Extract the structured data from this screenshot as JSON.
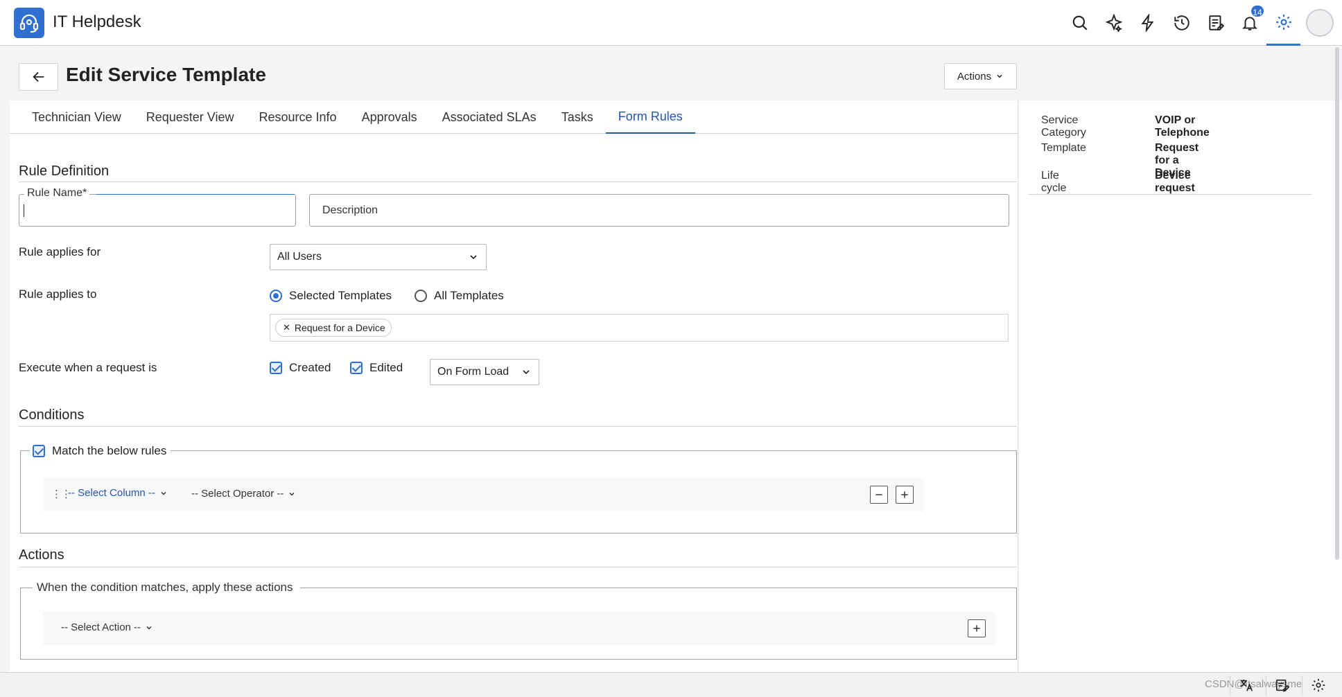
{
  "app": {
    "title": "IT Helpdesk"
  },
  "topbar": {
    "notification_count": "14"
  },
  "page": {
    "title": "Edit Service Template",
    "actions_label": "Actions"
  },
  "tabs": [
    {
      "label": "Technician View"
    },
    {
      "label": "Requester View"
    },
    {
      "label": "Resource Info"
    },
    {
      "label": "Approvals"
    },
    {
      "label": "Associated SLAs"
    },
    {
      "label": "Tasks"
    },
    {
      "label": "Form Rules"
    }
  ],
  "rule_definition": {
    "title": "Rule Definition",
    "rule_name_label": "Rule Name",
    "required_mark": "*",
    "rule_name_value": "",
    "description_placeholder": "Description",
    "applies_for_label": "Rule applies for",
    "applies_for_value": "All Users",
    "applies_to_label": "Rule applies to",
    "opt_selected": "Selected Templates",
    "opt_all": "All Templates",
    "template_tag": "Request for a Device",
    "execute_label": "Execute when a request is",
    "created_label": "Created",
    "edited_label": "Edited",
    "event_value": "On Form Load"
  },
  "conditions": {
    "title": "Conditions",
    "match_label": "Match the below rules",
    "select_column": "-- Select Column --",
    "select_operator": "-- Select Operator --"
  },
  "actions": {
    "title": "Actions",
    "group_label": "When the condition matches, apply these actions",
    "select_action": "-- Select Action --"
  },
  "details": [
    {
      "key": "Service Category",
      "value": "VOIP or Telephone"
    },
    {
      "key": "Template",
      "value": "Request for a Device"
    },
    {
      "key": "Life cycle",
      "value": "Device request"
    }
  ],
  "watermark": "CSDN@Itsalwaysme"
}
